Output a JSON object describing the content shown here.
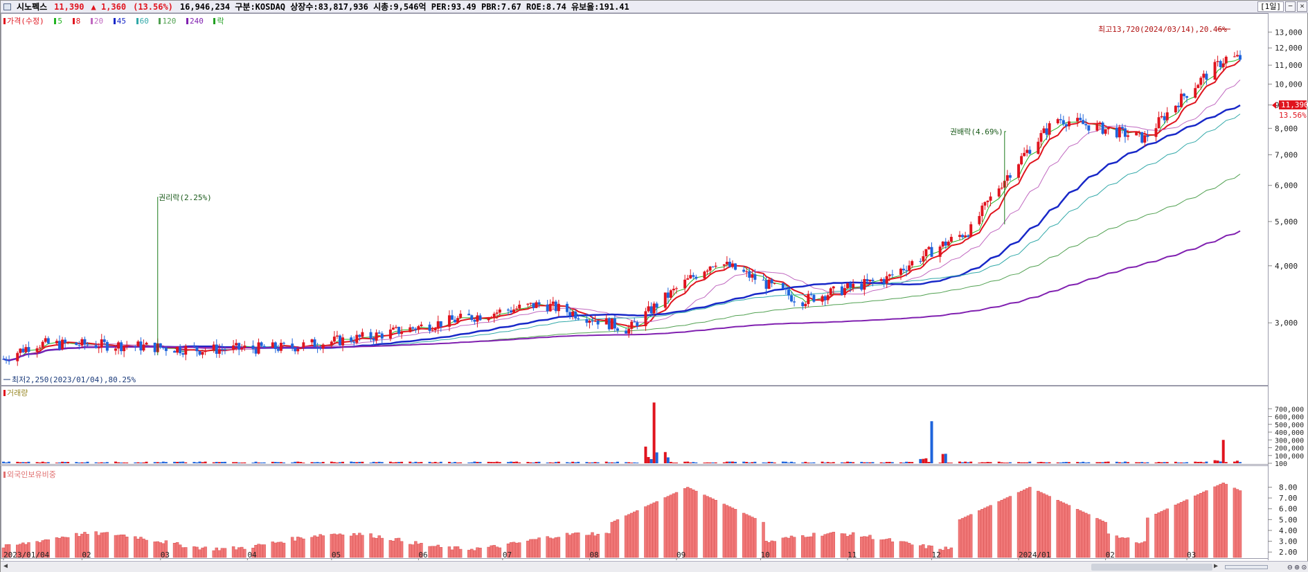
{
  "header": {
    "name": "시노펙스",
    "price": "11,390",
    "change": "▲ 1,360",
    "change_pct": "(13.56%)",
    "info": "16,946,234  구분:KOSDAQ 상장수:83,817,936 시총:9,546억 PER:93.49 PBR:7.67 ROE:8.74 유보율:191.41",
    "period": "[1일]"
  },
  "legend": {
    "price_label": "가격(수정)",
    "ma": [
      {
        "label": "5",
        "color": "#22b422"
      },
      {
        "label": "8",
        "color": "#e0141e"
      },
      {
        "label": "20",
        "color": "#c068c0"
      },
      {
        "label": "45",
        "color": "#1828c8"
      },
      {
        "label": "60",
        "color": "#30a8a8"
      },
      {
        "label": "120",
        "color": "#50a050"
      },
      {
        "label": "240",
        "color": "#8020b0"
      }
    ],
    "rak_label": "락"
  },
  "annotations": {
    "high": "최고13,720(2024/03/14),20.46%",
    "low": "최저2,250(2023/01/04),80.25%",
    "rights": "권리락(2.25%)",
    "bonus": "권배락(4.69%)"
  },
  "panels": {
    "volume_title": "거래량",
    "foreign_title": "외국인보유비중"
  },
  "price_marker": {
    "price": "11,390",
    "pct": "13.56%"
  },
  "x_labels": [
    "2023/01/04",
    "02",
    "03",
    "04",
    "05",
    "06",
    "07",
    "08",
    "09",
    "10",
    "11",
    "12",
    "2024/01",
    "02",
    "03"
  ],
  "colors": {
    "up": "#e0141e",
    "down": "#1e64dc",
    "volume_label": "#9a8a2a",
    "foreign_bar": "#f07878"
  },
  "chart_data": [
    {
      "type": "candlestick",
      "title": "가격(수정)",
      "y_ticks": [
        "3,000",
        "4,000",
        "5,000",
        "6,000",
        "7,000",
        "8,000",
        "9,000",
        "10,000",
        "11,000",
        "12,000",
        "13,000"
      ],
      "ylim": [
        2200,
        14200
      ],
      "x_range": [
        "2023/01/04",
        "2024/03/20"
      ],
      "monthly_close": [
        [
          "2023-01",
          2700
        ],
        [
          "2023-02",
          2680
        ],
        [
          "2023-03",
          2620
        ],
        [
          "2023-04",
          2650
        ],
        [
          "2023-05",
          2800
        ],
        [
          "2023-06",
          3050
        ],
        [
          "2023-07",
          3300
        ],
        [
          "2023-08",
          2900
        ],
        [
          "2023-09",
          4100
        ],
        [
          "2023-10",
          3350
        ],
        [
          "2023-11",
          3750
        ],
        [
          "2023-12",
          4800
        ],
        [
          "2024-01",
          8400
        ],
        [
          "2024-02",
          7600
        ],
        [
          "2024-03",
          11390
        ]
      ],
      "high": 13720,
      "low": 2250,
      "last": 11390
    },
    {
      "type": "bar",
      "title": "거래량",
      "y_ticks": [
        "100",
        "100,000",
        "200,000",
        "300,000",
        "400,000",
        "500,000",
        "600,000",
        "700,000"
      ],
      "ylim": [
        0,
        800000
      ],
      "spikes": [
        [
          "2023-08-24",
          780000
        ],
        [
          "2023-12-01",
          540000
        ],
        [
          "2024-03-14",
          300000
        ]
      ]
    },
    {
      "type": "bar",
      "title": "외국인보유비중",
      "y_ticks": [
        "2.00",
        "3.00",
        "4.00",
        "5.00",
        "6.00",
        "7.00",
        "8.00"
      ],
      "ylim": [
        1.5,
        8.8
      ],
      "peaks": [
        [
          "2023-09-05",
          8.0
        ],
        [
          "2024-01-05",
          8.0
        ],
        [
          "2024-03-14",
          8.4
        ]
      ]
    }
  ]
}
